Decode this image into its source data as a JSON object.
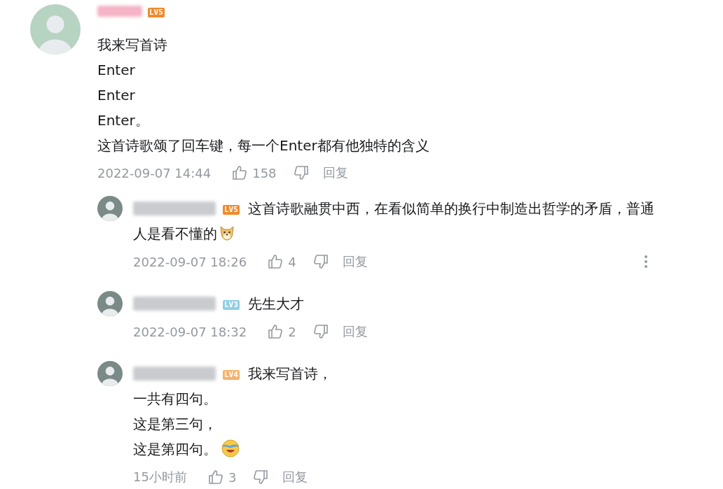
{
  "comment": {
    "name_blur": {
      "color": "#f5b3c6"
    },
    "level": {
      "text": "LV5",
      "color": "#f08a2c"
    },
    "lines": [
      "我来写首诗",
      "Enter",
      "Enter",
      "Enter。",
      "这首诗歌颂了回车键，每一个Enter都有他独特的含义"
    ],
    "time": "2022-09-07 14:44",
    "likes": "158",
    "reply_label": "回复"
  },
  "replies": [
    {
      "name_blur": {
        "color": "#c9cbcf"
      },
      "level": {
        "text": "LV5",
        "color": "#f08a2c"
      },
      "lines": [
        "这首诗歌融贯中西，在看似简单的换行中制造出哲学的矛盾，普通",
        "人是看不懂的"
      ],
      "sticker": {
        "kind": "dog"
      },
      "time": "2022-09-07 18:26",
      "likes": "4",
      "reply_label": "回复",
      "has_menu": true
    },
    {
      "name_blur": {
        "color": "#c9cbcf"
      },
      "level": {
        "text": "LV3",
        "color": "#8fd0e6"
      },
      "lines": [
        "先生大才"
      ],
      "time": "2022-09-07 18:32",
      "likes": "2",
      "reply_label": "回复",
      "has_menu": false
    },
    {
      "name_blur": {
        "color": "#c9cbcf"
      },
      "level": {
        "text": "LV4",
        "color": "#f5b36b"
      },
      "lines": [
        "我来写首诗，",
        "一共有四句。",
        "这是第三句，",
        "这是第四句。"
      ],
      "sticker": {
        "kind": "laugh"
      },
      "time": "15小时前",
      "likes": "3",
      "reply_label": "回复",
      "has_menu": false
    }
  ]
}
